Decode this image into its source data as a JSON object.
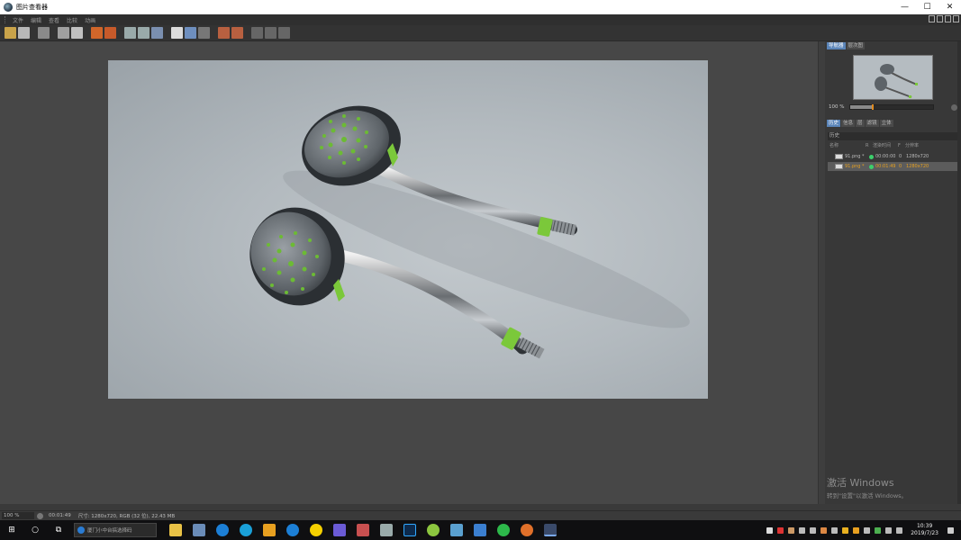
{
  "window": {
    "title": "图片查看器",
    "min": "—",
    "max": "☐",
    "close": "✕"
  },
  "menu": [
    "文件",
    "编辑",
    "查看",
    "比较",
    "动画"
  ],
  "panel": {
    "top_tabs": [
      "导航器",
      "层次图"
    ],
    "zoom": "100 %",
    "zoom_fraction": 0.27,
    "sub_tabs": [
      "历史",
      "信息",
      "层",
      "滤镜",
      "立体"
    ],
    "history_header": "历史",
    "columns": [
      "名称",
      "R",
      "渲染时间",
      "F",
      "分辨率"
    ],
    "rows": [
      {
        "name": "91.png *",
        "time": "00:00:00",
        "frame": "0",
        "res": "1280x720"
      },
      {
        "name": "91.png *",
        "time": "00:01:49",
        "frame": "0",
        "res": "1280x720"
      }
    ]
  },
  "watermark": {
    "line1": "激活 Windows",
    "line2": "转到\"设置\"以激活 Windows。"
  },
  "status": {
    "zoom": "100 %",
    "time": "00:01:49",
    "info": "尺寸: 1280x720, RGB (32 位), 22.43 MB"
  },
  "taskbar": {
    "search_placeholder": "厦门小中台搞选择码",
    "time": "10:39",
    "date": "2019/7/23"
  },
  "colors": {
    "accent_tab": "#5a84b8",
    "selected_row_text": "#e6a020",
    "status_dot": "#3ccf6b"
  }
}
